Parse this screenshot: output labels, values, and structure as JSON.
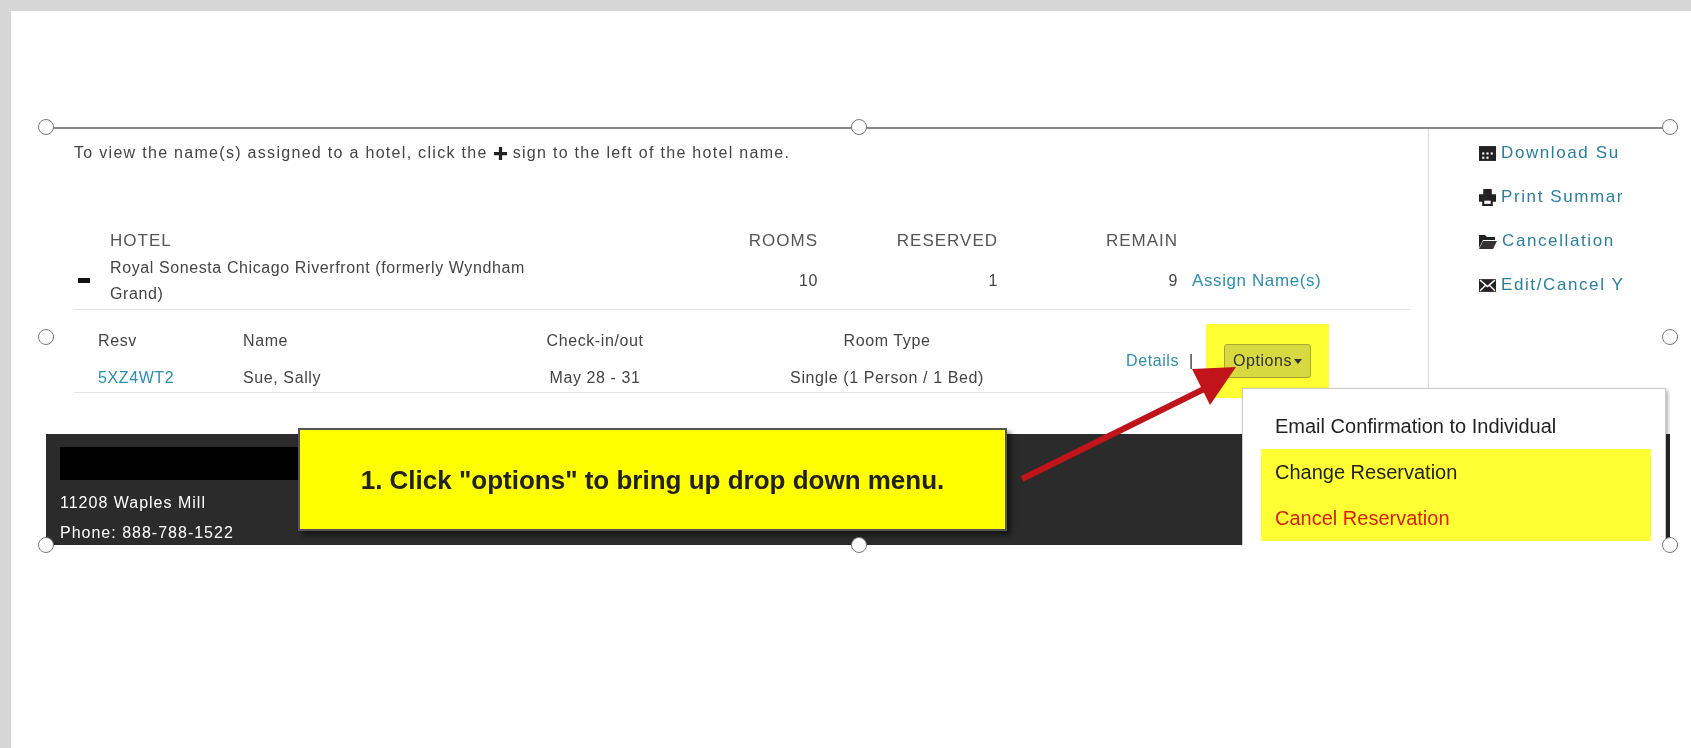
{
  "instruction": {
    "before": "To view the name(s) assigned to a hotel, click the",
    "after": "sign to the left of the hotel name."
  },
  "hotel_table": {
    "columns": [
      "HOTEL",
      "ROOMS",
      "RESERVED",
      "REMAIN"
    ],
    "rows": [
      {
        "expanded": true,
        "hotel": "Royal Sonesta Chicago Riverfront (formerly Wyndham Grand)",
        "rooms": "10",
        "reserved": "1",
        "remain": "9",
        "action": "Assign Name(s)",
        "reservations": {
          "columns": [
            "Resv",
            "Name",
            "Check-in/out",
            "Room Type"
          ],
          "rows": [
            {
              "resv": "5XZ4WT2",
              "name": "Sue, Sally",
              "dates": "May 28 - 31",
              "room_type": "Single (1 Person / 1 Bed)",
              "details": "Details",
              "separator": "|",
              "options": "Options",
              "options_highlighted": true
            }
          ]
        }
      }
    ]
  },
  "sidebar_links": [
    {
      "kind": "calendar",
      "label": "Download Su"
    },
    {
      "kind": "printer",
      "label": "Print Summar"
    },
    {
      "kind": "folder",
      "label": "Cancellation"
    },
    {
      "kind": "envelope",
      "label": "Edit/Cancel Y"
    }
  ],
  "footer": {
    "address": "11208 Waples Mill",
    "phone": "Phone: 888-788-1522"
  },
  "dropdown": [
    {
      "label": "Email Confirmation to Individual",
      "kind": "normal",
      "highlighted": false
    },
    {
      "label": "Change Reservation",
      "kind": "normal",
      "highlighted": true
    },
    {
      "label": "Cancel Reservation",
      "kind": "danger",
      "highlighted": true
    }
  ],
  "callout": {
    "text": "1. Click \"options\" to bring up drop down menu."
  }
}
